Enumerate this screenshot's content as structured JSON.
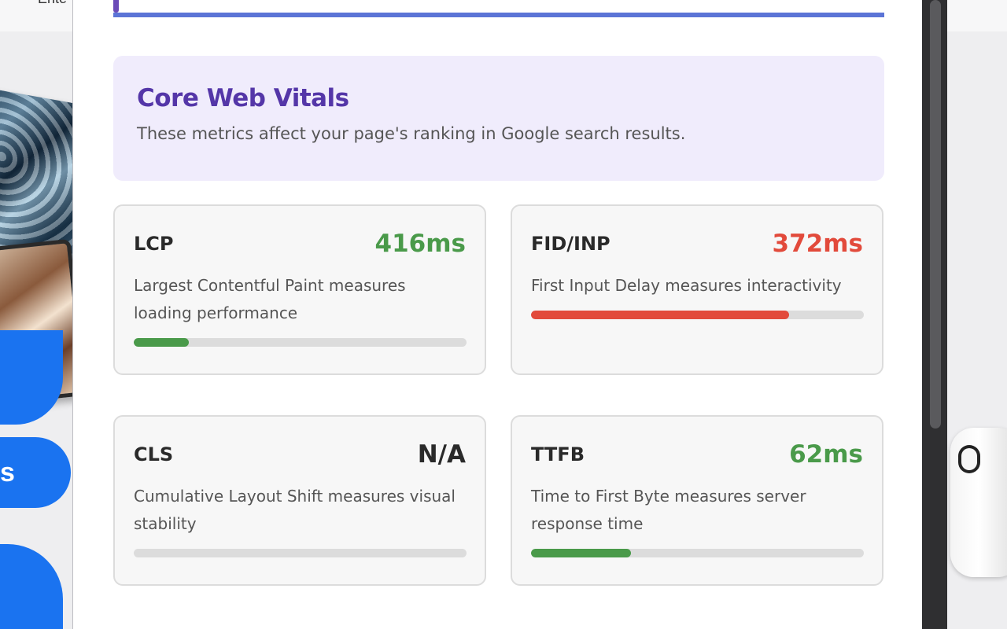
{
  "background": {
    "nav_text": "Ente",
    "bubble_text": "s"
  },
  "vitals": {
    "title": "Core Web Vitals",
    "subtitle": "These metrics affect your page's ranking in Google search results."
  },
  "metrics": [
    {
      "name": "LCP",
      "value": "416ms",
      "color": "#4a9a4a",
      "description": "Largest Contentful Paint measures loading performance",
      "progress": 0.165,
      "bar_color": "#4a9a4a"
    },
    {
      "name": "FID/INP",
      "value": "372ms",
      "color": "#e24a3b",
      "description": "First Input Delay measures interactivity",
      "progress": 0.775,
      "bar_color": "#e24a3b"
    },
    {
      "name": "CLS",
      "value": "N/A",
      "color": "#2a2a2a",
      "description": "Cumulative Layout Shift measures visual stability",
      "progress": 0,
      "bar_color": "#dcdcdc"
    },
    {
      "name": "TTFB",
      "value": "62ms",
      "color": "#4a9a4a",
      "description": "Time to First Byte measures server response time",
      "progress": 0.3,
      "bar_color": "#4a9a4a"
    }
  ]
}
